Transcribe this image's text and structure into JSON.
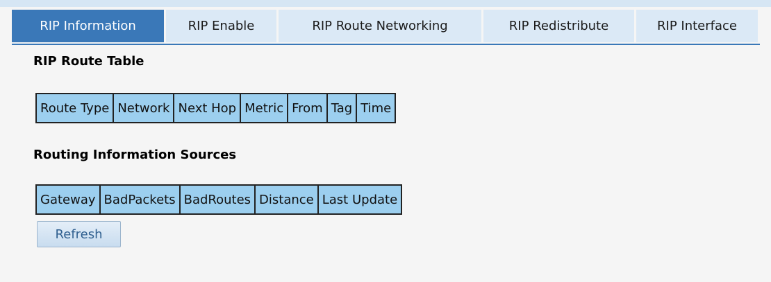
{
  "tabs": [
    {
      "label": "RIP Information",
      "active": true
    },
    {
      "label": "RIP Enable",
      "active": false
    },
    {
      "label": "RIP Route Networking",
      "active": false
    },
    {
      "label": "RIP Redistribute",
      "active": false
    },
    {
      "label": "RIP Interface",
      "active": false
    }
  ],
  "route_table": {
    "title": "RIP Route Table",
    "columns": [
      "Route Type",
      "Network",
      "Next Hop",
      "Metric",
      "From",
      "Tag",
      "Time"
    ]
  },
  "sources": {
    "title": "Routing Information Sources",
    "columns": [
      "Gateway",
      "BadPackets",
      "BadRoutes",
      "Distance",
      "Last Update"
    ]
  },
  "refresh_label": "Refresh",
  "colors": {
    "active_tab": "#3a78b8",
    "tab": "#dbe9f6",
    "header_cell": "#9ccfef",
    "background": "#f5f5f5"
  }
}
